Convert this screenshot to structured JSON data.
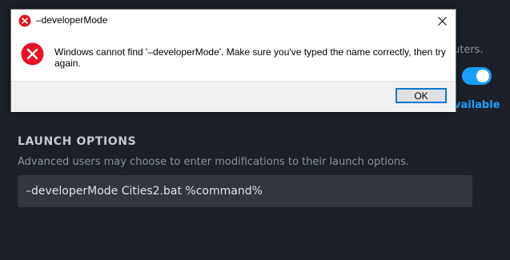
{
  "background": {
    "partial_text": "uters.",
    "toggle_on": true,
    "partial_link": "vailable",
    "launch_options": {
      "title": "LAUNCH OPTIONS",
      "description": "Advanced users may choose to enter modifications to their launch options.",
      "value": "–developerMode Cities2.bat %command%"
    }
  },
  "dialog": {
    "title": "–developerMode",
    "message": "Windows cannot find '–developerMode'. Make sure you've typed the name correctly, then try again.",
    "ok_label": "OK",
    "icon": "error-icon",
    "close_icon": "close-icon"
  },
  "colors": {
    "background": "#1b2029",
    "accent": "#1a9fff",
    "error_red": "#e81123"
  }
}
